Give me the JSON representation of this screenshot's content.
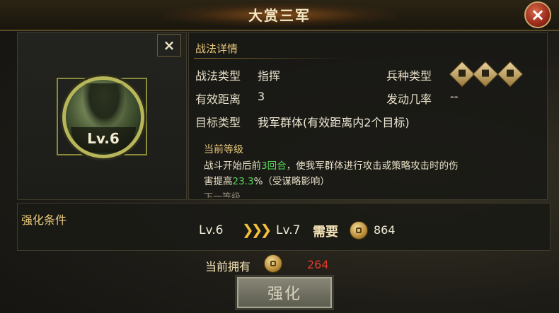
{
  "title": "大赏三军",
  "close_icon": "×",
  "panel_close_icon": "×",
  "skill": {
    "level": "Lv.6"
  },
  "details": {
    "section_title": "战法详情",
    "type_label": "战法类型",
    "type_value": "指挥",
    "unit_label": "兵种类型",
    "unit_icons": [
      "cavalry-icon",
      "shield-icon",
      "horse-icon"
    ],
    "range_label": "有效距离",
    "range_value": "3",
    "rate_label": "发动几率",
    "rate_value": "--",
    "target_label": "目标类型",
    "target_value": "我军群体(有效距离内2个目标)",
    "current_level_title": "当前等级",
    "desc_part1": "战斗开始后前",
    "desc_rounds": "3回合",
    "desc_part2": "，使我军群体进行攻击或策略攻击时的伤",
    "desc_part3": "害提高",
    "desc_percent": "23.3",
    "desc_part4": "%（受谋略影响）",
    "next_level_title": "下一等级"
  },
  "strengthen": {
    "label": "强化条件",
    "from_level": "Lv.6",
    "arrows": "❯❯❯",
    "to_level": "Lv.7",
    "need_label": "需要",
    "need_value": "864",
    "own_label": "当前拥有",
    "own_value": "264",
    "button_label": "强化"
  },
  "colors": {
    "accent_gold": "#e8c87a",
    "highlight_green": "#59d35a",
    "insufficient_red": "#e23b2a"
  }
}
